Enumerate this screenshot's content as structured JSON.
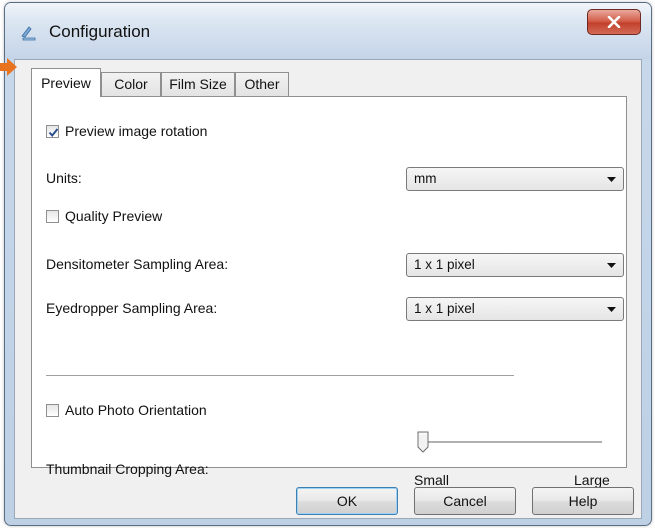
{
  "window": {
    "title": "Configuration",
    "close_glyph": "x"
  },
  "tabs": [
    {
      "label": "Preview",
      "active": true
    },
    {
      "label": "Color"
    },
    {
      "label": "Film Size"
    },
    {
      "label": "Other"
    }
  ],
  "preview": {
    "preview_rotation": {
      "label": "Preview image rotation",
      "checked": true
    },
    "units": {
      "label": "Units:",
      "value": "mm"
    },
    "quality_preview": {
      "label": "Quality Preview",
      "checked": false
    },
    "densitometer": {
      "label": "Densitometer Sampling Area:",
      "value": "1 x 1 pixel"
    },
    "eyedropper": {
      "label": "Eyedropper Sampling Area:",
      "value": "1 x 1 pixel"
    },
    "auto_orientation": {
      "label": "Auto Photo Orientation",
      "checked": false
    },
    "thumbnail": {
      "label": "Thumbnail Cropping Area:",
      "min_label": "Small",
      "max_label": "Large",
      "position": 0
    }
  },
  "buttons": {
    "ok": "OK",
    "cancel": "Cancel",
    "help": "Help"
  },
  "colors": {
    "accent_arrow": "#e8731f",
    "close_red": "#c7432f",
    "focus_blue": "#3c7fb1"
  },
  "icons": {
    "app": "scanner-app-icon",
    "close": "close-icon",
    "dropdown": "chevron-down-icon",
    "check": "check-icon"
  }
}
